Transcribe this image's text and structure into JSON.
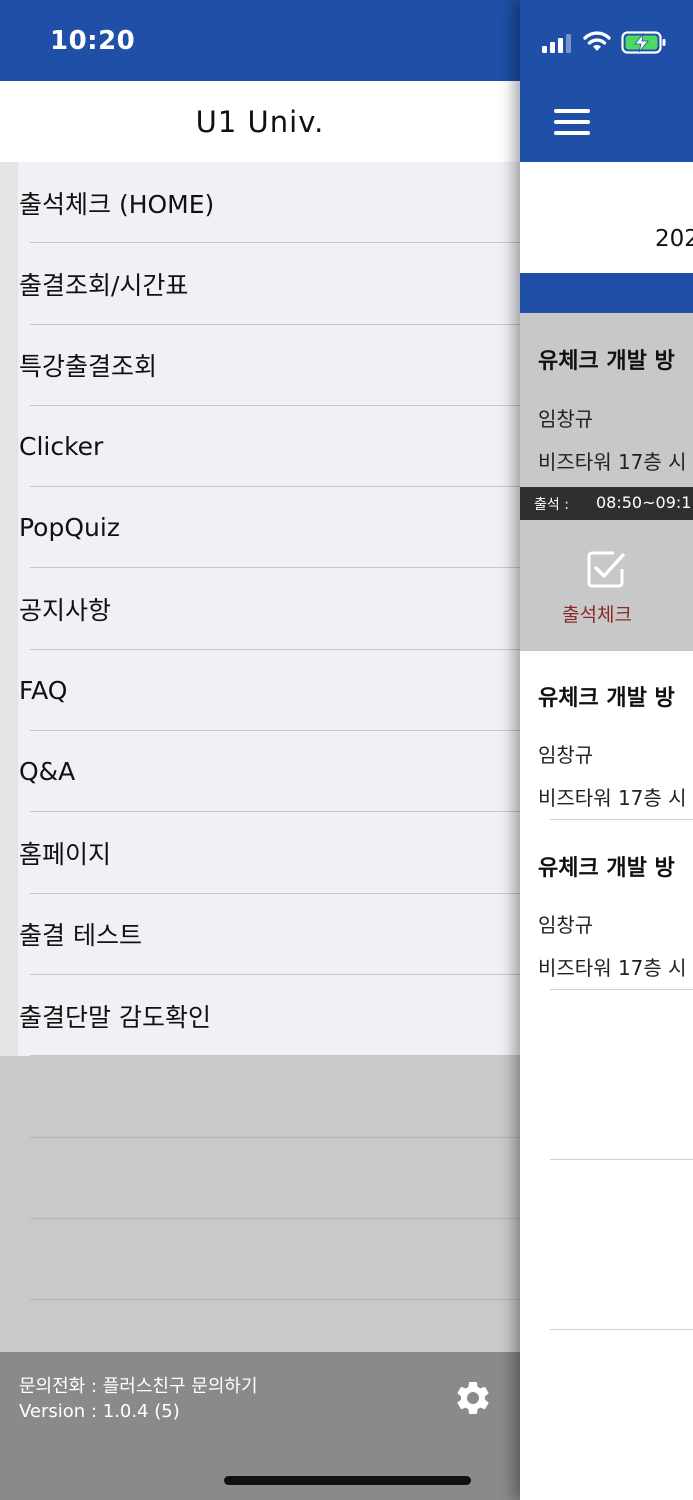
{
  "status_bar": {
    "time": "10:20"
  },
  "drawer": {
    "title": "U1 Univ.",
    "menu": [
      "출석체크 (HOME)",
      "출결조회/시간표",
      "특강출결조회",
      "Clicker",
      "PopQuiz",
      "공지사항",
      "FAQ",
      "Q&A",
      "홈페이지",
      "출결 테스트",
      "출결단말 감도확인"
    ],
    "footer": {
      "contact": "문의전화 :  플러스친구 문의하기",
      "version": "Version :  1.0.4 (5)"
    }
  },
  "main": {
    "date_partial": "202",
    "courses": [
      {
        "title": "유체크 개발 방",
        "professor": "임창규",
        "room": "비즈타워 17층 시"
      },
      {
        "title": "유체크 개발 방",
        "professor": "임창규",
        "room": "비즈타워 17층 시"
      },
      {
        "title": "유체크 개발 방",
        "professor": "임창규",
        "room": "비즈타워 17층 시"
      }
    ],
    "attendance": {
      "label": "출석 :",
      "time": "08:50~09:1"
    },
    "check_button_label": "출석체크"
  },
  "colors": {
    "brand_blue": "#1f4fa6",
    "check_label": "#8b2a2a",
    "battery_green": "#4cd964"
  },
  "icons": [
    "signal-icon",
    "wifi-icon",
    "battery-icon",
    "menu-icon",
    "gear-icon",
    "checkbox-icon"
  ]
}
